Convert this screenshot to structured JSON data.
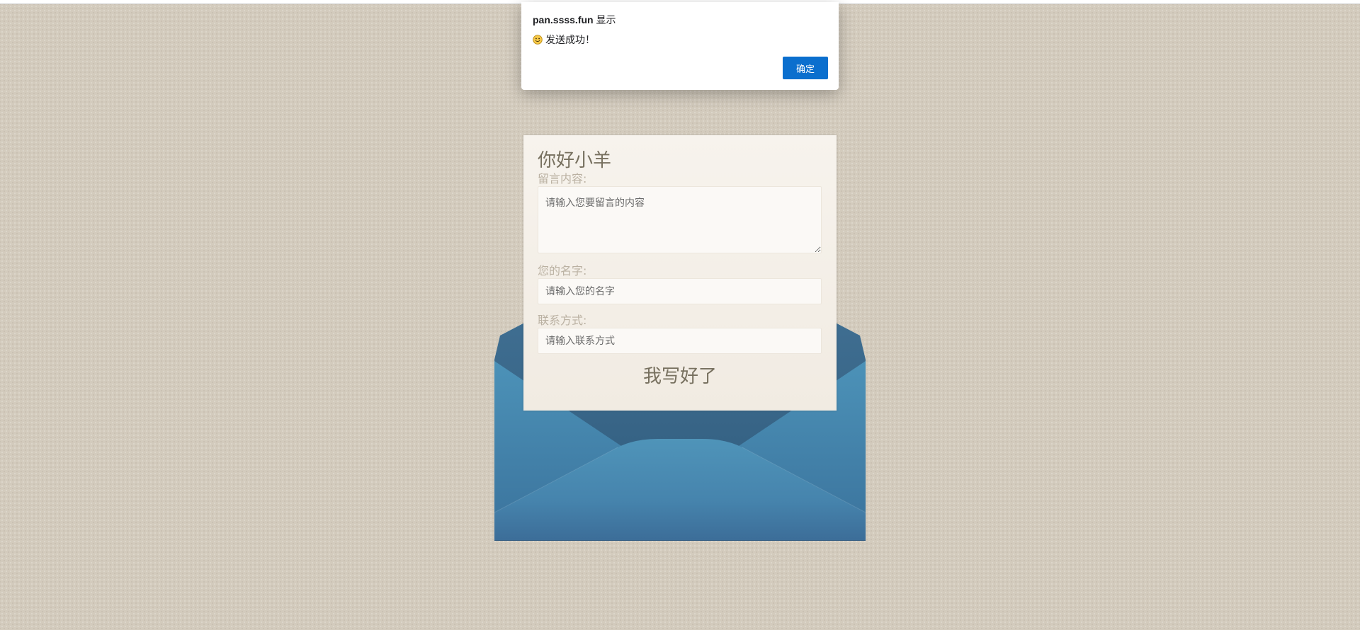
{
  "dialog": {
    "origin": "pan.ssss.fun",
    "origin_suffix": "显示",
    "emoji": "smiley-face-icon",
    "message": "发送成功！",
    "ok_label": "确定"
  },
  "letter": {
    "greeting": "你好小羊",
    "message_label": "留言内容:",
    "message_placeholder": "请输入您要留言的内容",
    "name_label": "您的名字:",
    "name_placeholder": "请输入您的名字",
    "contact_label": "联系方式:",
    "contact_placeholder": "请输入联系方式",
    "submit_label": "我写好了"
  },
  "colors": {
    "background": "#d3cbbd",
    "envelope_blue": "#4a8fb4",
    "envelope_dark": "#3b6f97",
    "letter_paper": "#f4efe8",
    "dialog_button": "#0b6fce"
  }
}
